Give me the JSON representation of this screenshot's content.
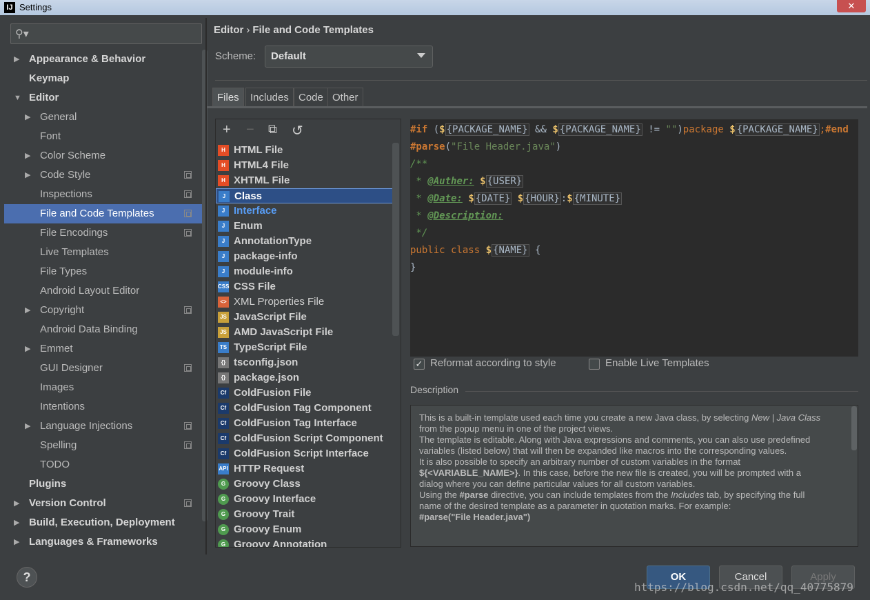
{
  "window": {
    "title": "Settings",
    "app_icon": "IJ",
    "close_label": "✕"
  },
  "search": {
    "placeholder": ""
  },
  "sidebar": {
    "items": [
      {
        "label": "Appearance & Behavior",
        "level": 0,
        "arrow": "▶",
        "bold": true
      },
      {
        "label": "Keymap",
        "level": 0,
        "arrow": "",
        "bold": true
      },
      {
        "label": "Editor",
        "level": 0,
        "arrow": "▼",
        "bold": true
      },
      {
        "label": "General",
        "level": 1,
        "arrow": "▶"
      },
      {
        "label": "Font",
        "level": 1,
        "arrow": ""
      },
      {
        "label": "Color Scheme",
        "level": 1,
        "arrow": "▶"
      },
      {
        "label": "Code Style",
        "level": 1,
        "arrow": "▶",
        "cfg": true
      },
      {
        "label": "Inspections",
        "level": 1,
        "arrow": "",
        "cfg": true
      },
      {
        "label": "File and Code Templates",
        "level": 1,
        "arrow": "",
        "cfg": true,
        "selected": true
      },
      {
        "label": "File Encodings",
        "level": 1,
        "arrow": "",
        "cfg": true
      },
      {
        "label": "Live Templates",
        "level": 1,
        "arrow": ""
      },
      {
        "label": "File Types",
        "level": 1,
        "arrow": ""
      },
      {
        "label": "Android Layout Editor",
        "level": 1,
        "arrow": ""
      },
      {
        "label": "Copyright",
        "level": 1,
        "arrow": "▶",
        "cfg": true
      },
      {
        "label": "Android Data Binding",
        "level": 1,
        "arrow": ""
      },
      {
        "label": "Emmet",
        "level": 1,
        "arrow": "▶"
      },
      {
        "label": "GUI Designer",
        "level": 1,
        "arrow": "",
        "cfg": true
      },
      {
        "label": "Images",
        "level": 1,
        "arrow": ""
      },
      {
        "label": "Intentions",
        "level": 1,
        "arrow": ""
      },
      {
        "label": "Language Injections",
        "level": 1,
        "arrow": "▶",
        "cfg": true
      },
      {
        "label": "Spelling",
        "level": 1,
        "arrow": "",
        "cfg": true
      },
      {
        "label": "TODO",
        "level": 1,
        "arrow": ""
      },
      {
        "label": "Plugins",
        "level": 0,
        "arrow": "",
        "bold": true
      },
      {
        "label": "Version Control",
        "level": 0,
        "arrow": "▶",
        "bold": true,
        "cfg": true
      },
      {
        "label": "Build, Execution, Deployment",
        "level": 0,
        "arrow": "▶",
        "bold": true
      },
      {
        "label": "Languages & Frameworks",
        "level": 0,
        "arrow": "▶",
        "bold": true
      }
    ]
  },
  "breadcrumb": {
    "parent": "Editor",
    "separator": "›",
    "current": "File and Code Templates"
  },
  "scheme": {
    "label": "Scheme:",
    "value": "Default"
  },
  "tabs": [
    {
      "label": "Files",
      "active": true
    },
    {
      "label": "Includes"
    },
    {
      "label": "Code"
    },
    {
      "label": "Other"
    }
  ],
  "toolbar": {
    "add": "+",
    "remove": "−",
    "copy": "⧉",
    "reset": "↺"
  },
  "files": [
    {
      "name": "HTML File",
      "icon": "H",
      "color": "#e44d26"
    },
    {
      "name": "HTML4 File",
      "icon": "H",
      "color": "#e44d26"
    },
    {
      "name": "XHTML File",
      "icon": "H",
      "color": "#e44d26"
    },
    {
      "name": "Class",
      "icon": "J",
      "color": "#3a7dc9",
      "selected": true
    },
    {
      "name": "Interface",
      "icon": "J",
      "color": "#3a7dc9",
      "blue": true
    },
    {
      "name": "Enum",
      "icon": "J",
      "color": "#3a7dc9"
    },
    {
      "name": "AnnotationType",
      "icon": "J",
      "color": "#3a7dc9"
    },
    {
      "name": "package-info",
      "icon": "J",
      "color": "#3a7dc9"
    },
    {
      "name": "module-info",
      "icon": "J",
      "color": "#3a7dc9"
    },
    {
      "name": "CSS File",
      "icon": "CSS",
      "color": "#3a7dc9"
    },
    {
      "name": "XML Properties File",
      "icon": "<>",
      "color": "#d9633a",
      "plain": true
    },
    {
      "name": "JavaScript File",
      "icon": "JS",
      "color": "#c9a03a"
    },
    {
      "name": "AMD JavaScript File",
      "icon": "JS",
      "color": "#c9a03a"
    },
    {
      "name": "TypeScript File",
      "icon": "TS",
      "color": "#3a7dc9"
    },
    {
      "name": "tsconfig.json",
      "icon": "{}",
      "color": "#777777"
    },
    {
      "name": "package.json",
      "icon": "{}",
      "color": "#777777"
    },
    {
      "name": "ColdFusion File",
      "icon": "Cf",
      "color": "#1b3a6b"
    },
    {
      "name": "ColdFusion Tag Component",
      "icon": "Cf",
      "color": "#1b3a6b"
    },
    {
      "name": "ColdFusion Tag Interface",
      "icon": "Cf",
      "color": "#1b3a6b"
    },
    {
      "name": "ColdFusion Script Component",
      "icon": "Cf",
      "color": "#1b3a6b"
    },
    {
      "name": "ColdFusion Script Interface",
      "icon": "Cf",
      "color": "#1b3a6b"
    },
    {
      "name": "HTTP Request",
      "icon": "API",
      "color": "#3a7dc9"
    },
    {
      "name": "Groovy Class",
      "icon": "G",
      "color": "#4f9a4f",
      "round": true
    },
    {
      "name": "Groovy Interface",
      "icon": "G",
      "color": "#4f9a4f",
      "round": true
    },
    {
      "name": "Groovy Trait",
      "icon": "G",
      "color": "#4f9a4f",
      "round": true
    },
    {
      "name": "Groovy Enum",
      "icon": "G",
      "color": "#4f9a4f",
      "round": true
    },
    {
      "name": "Groovy Annotation",
      "icon": "G",
      "color": "#4f9a4f",
      "round": true
    }
  ],
  "editor": {
    "line1": {
      "d1": "#if",
      "p1": " (",
      "s1": "$",
      "v1": "{PACKAGE_NAME}",
      "op": " && ",
      "s2": "$",
      "v2": "{PACKAGE_NAME}",
      "neq": " != ",
      "str": "\"\"",
      "cp": ")",
      "pkg": "package",
      "sp": " ",
      "s3": "$",
      "v3": "{PACKAGE_NAME}",
      "semi": ";",
      "end": "#end"
    },
    "line2": {
      "d": "#parse",
      "lp": "(",
      "str": "\"File Header.java\"",
      "rp": ")"
    },
    "line3": "/**",
    "line4": {
      "star": " * ",
      "tag": "@Auther:",
      "sp": " ",
      "s": "$",
      "v": "{USER}"
    },
    "line5": {
      "star": " * ",
      "tag": "@Date:",
      "sp": " ",
      "s1": "$",
      "v1": "{DATE}",
      "sp2": " ",
      "s2": "$",
      "v2": "{HOUR}",
      "colon": ":",
      "s3": "$",
      "v3": "{MINUTE}"
    },
    "line6": {
      "star": " * ",
      "tag": "@Description:"
    },
    "line7": " */",
    "line8": {
      "kw": "public class ",
      "s": "$",
      "v": "{NAME}",
      "rest": " {"
    },
    "line9": "}"
  },
  "options": {
    "reformat": "Reformat according to style",
    "live": "Enable Live Templates",
    "reformat_checked": "✓"
  },
  "description": {
    "label": "Description",
    "p1a": "This is a built-in template used each time you create a new Java class, by selecting ",
    "p1b": "New | Java Class",
    "p1c": " from the popup menu in one of the project views.",
    "p2": "The template is editable. Along with Java expressions and comments, you can also use predefined variables (listed below) that will then be expanded like macros into the corresponding values.",
    "p3a": "It is also possible to specify an arbitrary number of custom variables in the format ",
    "p3b": "${<VARIABLE_NAME>}",
    "p3c": ". In this case, before the new file is created, you will be prompted with a dialog where you can define particular values for all custom variables.",
    "p4a": "Using the ",
    "p4b": "#parse",
    "p4c": " directive, you can include templates from the ",
    "p4d": "Includes",
    "p4e": " tab, by specifying the full name of the desired template as a parameter in quotation marks. For example:",
    "p5": "#parse(\"File Header.java\")"
  },
  "buttons": {
    "help": "?",
    "ok": "OK",
    "cancel": "Cancel",
    "apply": "Apply"
  },
  "watermark": "https://blog.csdn.net/qq_40775879"
}
